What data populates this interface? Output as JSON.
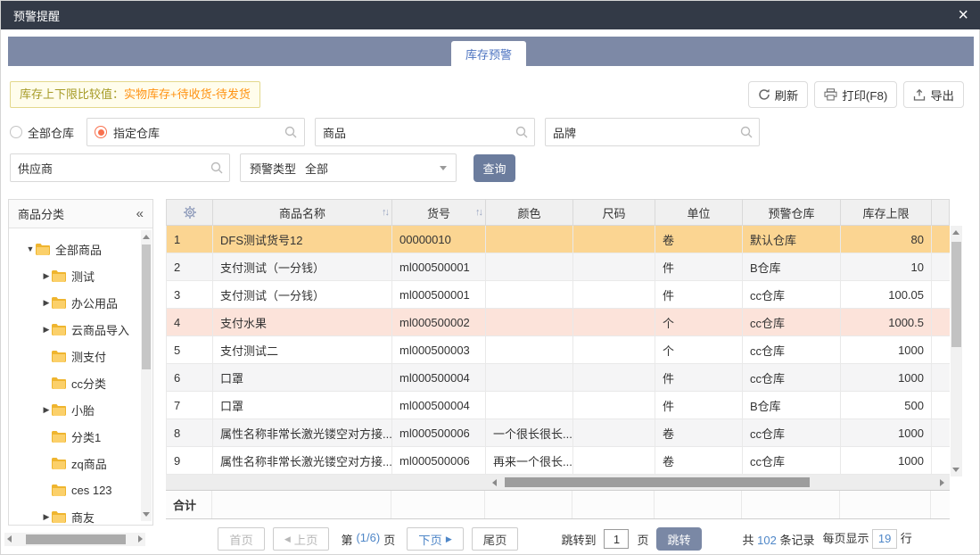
{
  "dialog": {
    "title": "预警提醒",
    "close": "×"
  },
  "tab": {
    "label": "库存预警"
  },
  "notice": {
    "label": "库存上下限比较值：",
    "value": "实物库存+待收货-待发货"
  },
  "toolbar": {
    "refresh": "刷新",
    "print": "打印(F8)",
    "export": "导出"
  },
  "filters": {
    "all_warehouse": "全部仓库",
    "specified_warehouse": "指定仓库",
    "product": "商品",
    "brand": "品牌",
    "supplier": "供应商",
    "type_label": "预警类型",
    "type_value": "全部",
    "query": "查询"
  },
  "sidebar": {
    "title": "商品分类",
    "collapse": "«",
    "tree": [
      {
        "label": "全部商品",
        "exp": "▼"
      },
      {
        "label": "测试",
        "exp": "▶"
      },
      {
        "label": "办公用品",
        "exp": "▶"
      },
      {
        "label": "云商品导入",
        "exp": "▶"
      },
      {
        "label": "测支付",
        "exp": ""
      },
      {
        "label": "cc分类",
        "exp": ""
      },
      {
        "label": "小胎",
        "exp": "▶"
      },
      {
        "label": "分类1",
        "exp": ""
      },
      {
        "label": "zq商品",
        "exp": ""
      },
      {
        "label": "ces 123",
        "exp": ""
      },
      {
        "label": "商友",
        "exp": "▶"
      }
    ]
  },
  "table": {
    "headers": {
      "name": "商品名称",
      "code": "货号",
      "color": "颜色",
      "size": "尺码",
      "unit": "单位",
      "warehouse": "预警仓库",
      "upper": "库存上限",
      "sort": "↑↓"
    },
    "rows": [
      {
        "seq": "1",
        "name": "DFS测试货号12",
        "code": "00000010",
        "color": "",
        "size": "",
        "unit": "卷",
        "warehouse": "默认仓库",
        "upper": "80"
      },
      {
        "seq": "2",
        "name": "支付测试（一分钱）",
        "code": "ml000500001",
        "color": "",
        "size": "",
        "unit": "件",
        "warehouse": "B仓库",
        "upper": "10"
      },
      {
        "seq": "3",
        "name": "支付测试（一分钱）",
        "code": "ml000500001",
        "color": "",
        "size": "",
        "unit": "件",
        "warehouse": "cc仓库",
        "upper": "100.05"
      },
      {
        "seq": "4",
        "name": "支付水果",
        "code": "ml000500002",
        "color": "",
        "size": "",
        "unit": "个",
        "warehouse": "cc仓库",
        "upper": "1000.5"
      },
      {
        "seq": "5",
        "name": "支付测试二",
        "code": "ml000500003",
        "color": "",
        "size": "",
        "unit": "个",
        "warehouse": "cc仓库",
        "upper": "1000"
      },
      {
        "seq": "6",
        "name": "口罩",
        "code": "ml000500004",
        "color": "",
        "size": "",
        "unit": "件",
        "warehouse": "cc仓库",
        "upper": "1000"
      },
      {
        "seq": "7",
        "name": "口罩",
        "code": "ml000500004",
        "color": "",
        "size": "",
        "unit": "件",
        "warehouse": "B仓库",
        "upper": "500"
      },
      {
        "seq": "8",
        "name": "属性名称非常长激光镂空对方接...",
        "code": "ml000500006",
        "color": "一个很长很长...",
        "size": "",
        "unit": "卷",
        "warehouse": "cc仓库",
        "upper": "1000"
      },
      {
        "seq": "9",
        "name": "属性名称非常长激光镂空对方接...",
        "code": "ml000500006",
        "color": "再来一个很长...",
        "size": "",
        "unit": "卷",
        "warehouse": "cc仓库",
        "upper": "1000"
      }
    ],
    "total_label": "合计"
  },
  "pagination": {
    "first": "首页",
    "prev": "上页",
    "page_pre": "第",
    "page_info": "(1/6)",
    "page_post": "页",
    "next": "下页",
    "last": "尾页",
    "jump_label": "跳转到",
    "jump_value": "1",
    "jump_unit": "页",
    "jump_btn": "跳转",
    "total_pre": "共",
    "total_count": "102",
    "total_post": "条记录",
    "pagesize_pre": "每页显示",
    "pagesize_value": "19",
    "pagesize_post": "行"
  },
  "colors": {
    "titlebar": "#333a47",
    "tabbar": "#7d89a6",
    "accent_blue": "#4f87c8",
    "row_orange": "#fbd592",
    "row_pink": "#fce3da",
    "radio_orange": "#f8714e",
    "notice_label": "#a69b27",
    "notice_value": "#ff9212",
    "query_button": "#6b7c9d"
  }
}
